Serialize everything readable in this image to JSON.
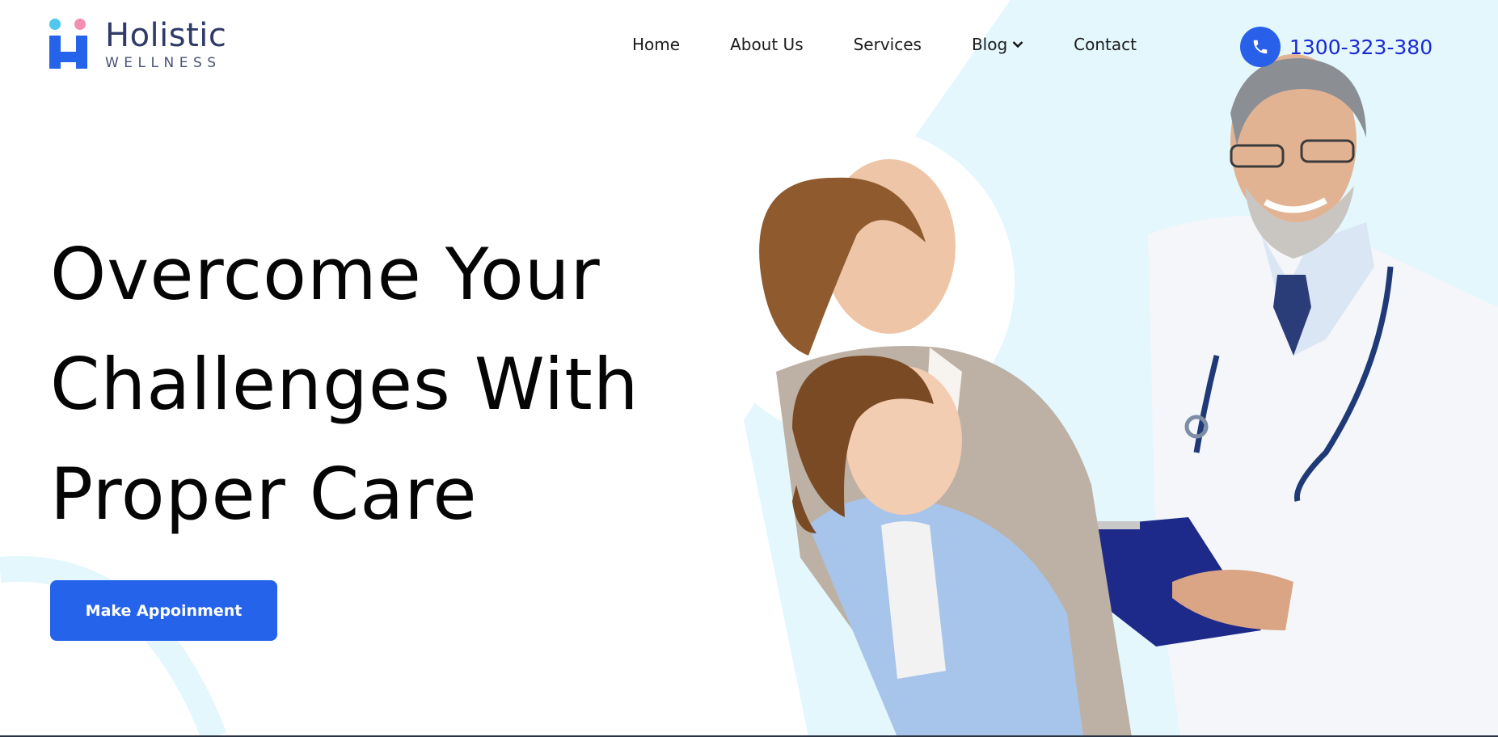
{
  "brand": {
    "name": "Holistic",
    "tagline": "WELLNESS"
  },
  "nav": {
    "items": [
      "Home",
      "About Us",
      "Services",
      "Blog",
      "Contact"
    ]
  },
  "contact": {
    "phone": "1300-323-380"
  },
  "hero": {
    "title_lines": [
      "Overcome Your",
      "Challenges With",
      "Proper Care"
    ],
    "cta_label": "Make Appoinment"
  },
  "colors": {
    "accent": "#2563eb",
    "brand_text": "#2f3a68",
    "bg_shape": "#e3f7fd",
    "phone_link": "#1a29d6"
  }
}
